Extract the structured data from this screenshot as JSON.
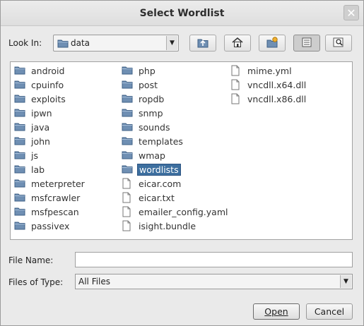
{
  "dialog": {
    "title": "Select Wordlist",
    "close_glyph": "✕"
  },
  "look_in": {
    "label": "Look In:",
    "value": "data"
  },
  "toolbar": {
    "buttons": [
      {
        "name": "up-one-level",
        "icon": "folder-up-icon"
      },
      {
        "name": "home",
        "icon": "home-icon"
      },
      {
        "name": "new-folder",
        "icon": "new-folder-icon"
      },
      {
        "name": "list-view",
        "icon": "list-view-icon",
        "pressed": true
      },
      {
        "name": "details-view",
        "icon": "details-view-icon"
      }
    ]
  },
  "files": {
    "columns": [
      [
        {
          "name": "android",
          "type": "folder"
        },
        {
          "name": "cpuinfo",
          "type": "folder"
        },
        {
          "name": "exploits",
          "type": "folder"
        },
        {
          "name": "ipwn",
          "type": "folder"
        },
        {
          "name": "java",
          "type": "folder"
        },
        {
          "name": "john",
          "type": "folder"
        },
        {
          "name": "js",
          "type": "folder"
        },
        {
          "name": "lab",
          "type": "folder"
        },
        {
          "name": "meterpreter",
          "type": "folder"
        },
        {
          "name": "msfcrawler",
          "type": "folder"
        },
        {
          "name": "msfpescan",
          "type": "folder"
        },
        {
          "name": "passivex",
          "type": "folder"
        }
      ],
      [
        {
          "name": "php",
          "type": "folder"
        },
        {
          "name": "post",
          "type": "folder"
        },
        {
          "name": "ropdb",
          "type": "folder"
        },
        {
          "name": "snmp",
          "type": "folder"
        },
        {
          "name": "sounds",
          "type": "folder"
        },
        {
          "name": "templates",
          "type": "folder"
        },
        {
          "name": "wmap",
          "type": "folder"
        },
        {
          "name": "wordlists",
          "type": "folder",
          "selected": true
        },
        {
          "name": "eicar.com",
          "type": "file"
        },
        {
          "name": "eicar.txt",
          "type": "file"
        },
        {
          "name": "emailer_config.yaml",
          "type": "file"
        },
        {
          "name": "isight.bundle",
          "type": "file"
        }
      ],
      [
        {
          "name": "mime.yml",
          "type": "file"
        },
        {
          "name": "vncdll.x64.dll",
          "type": "file"
        },
        {
          "name": "vncdll.x86.dll",
          "type": "file"
        }
      ]
    ]
  },
  "file_name": {
    "label": "File Name:",
    "value": ""
  },
  "file_type": {
    "label": "Files of Type:",
    "value": "All Files"
  },
  "buttons": {
    "open_label": "Open",
    "cancel_label": "Cancel"
  },
  "colors": {
    "selection": "#3d6f9f",
    "folder": "#5b7fa6"
  }
}
